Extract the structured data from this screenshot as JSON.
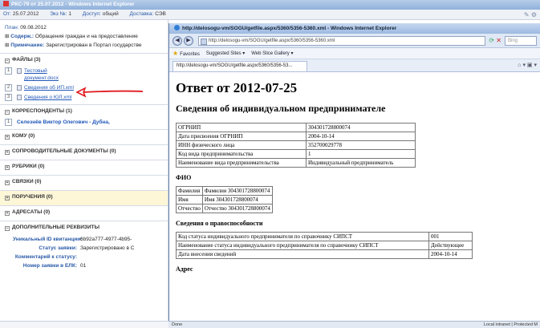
{
  "back_window": {
    "title": "РКС-79 от 25.07.2012 - Windows Internet Explorer",
    "meta": {
      "from_label": "От:",
      "from_value": "25.07.2012",
      "copy_label": "Экз №:",
      "copy_value": "1",
      "access_label": "Доступ:",
      "access_value": "общий",
      "delivery_label": "Доставка:",
      "delivery_value": "СЭВ"
    },
    "plan_label": "План:",
    "plan_value": "09.08.2012",
    "content_label": "Содерж.:",
    "content_value": "Обращения граждан и на предоставление",
    "note_label": "Примечание:",
    "note_value": "Зарегистрирован в Портал государстве",
    "files": {
      "header": "ФАЙЛЫ (3)",
      "items": [
        {
          "num": "1",
          "name": "Тестовый документ.docx"
        },
        {
          "num": "2",
          "name": "Сведения об ИП.xml"
        },
        {
          "num": "3",
          "name": "Сведения о ЮЛ.xml"
        }
      ]
    },
    "correspondents": {
      "header": "КОРРЕСПОНДЕНТЫ (1)",
      "items": [
        {
          "num": "1",
          "name": "Селезнёв Виктор Олегович - Дубна,"
        }
      ]
    },
    "sections": [
      {
        "header": "КОМУ (0)"
      },
      {
        "header": "СОПРОВОДИТЕЛЬНЫЕ ДОКУМЕНТЫ (0)"
      },
      {
        "header": "РУБРИКИ (0)"
      },
      {
        "header": "СВЯЗКИ (0)"
      },
      {
        "header": "ПОРУЧЕНИЯ (0)"
      },
      {
        "header": "АДРЕСАТЫ (0)"
      }
    ],
    "extra": {
      "header": "ДОПОЛНИТЕЛЬНЫЕ РЕКВИЗИТЫ",
      "rows": [
        {
          "k": "Уникальный ID квитанции:",
          "v": "6b92a777-4977-4b95-"
        },
        {
          "k": "Статус заявки:",
          "v": "Зарегистрировано в С"
        },
        {
          "k": "Комментарий к статусу:",
          "v": ""
        },
        {
          "k": "Номер заявки в ЕЛК:",
          "v": "01"
        }
      ]
    }
  },
  "popup": {
    "title": "http://delosogu-vm/SOGU/getfile.aspx/5360/5356-5360.xml - Windows Internet Explorer",
    "address": "http://delosogu-vm/SOGU/getfile.aspx/5360/5356-5360.xml",
    "search_placeholder": "Bing",
    "favorites": "Favorites",
    "suggested": "Suggested Sites ▾",
    "gallery": "Web Slice Gallery ▾",
    "tab_label": "http://delosogu-vm/SOGU/getfile.aspx/5360/5356-53...",
    "status_left": "Done",
    "status_right": "Local intranet | Protected M",
    "doc": {
      "title": "Ответ от 2012-07-25",
      "subtitle": "Сведения об индивидуальном предпринимателе",
      "main_table": [
        [
          "ОГРНИП",
          "304301728800074"
        ],
        [
          "Дата присвоения ОГРНИП",
          "2004-10-14"
        ],
        [
          "ИНН физического лица",
          "352700029778"
        ],
        [
          "Код вида предпринимательства",
          "1"
        ],
        [
          "Наименование вида предпринимательства",
          "Индивидуальный предприниматель"
        ]
      ],
      "fio_heading": "ФИО",
      "fio_table": [
        [
          "Фамилия",
          "Фамилия 304301728800074"
        ],
        [
          "Имя",
          "Имя 304301728800074"
        ],
        [
          "Отчество",
          "Отчество 304301728800074"
        ]
      ],
      "legal_heading": "Сведения о правоспособности",
      "legal_table": [
        [
          "Код статуса индивидуального предпринимателя по справочнику СИПСТ",
          "001"
        ],
        [
          "Наименование статуса индивидуального предпринимателя по справочнику СИПСТ",
          "Действующее"
        ],
        [
          "Дата внесения сведений",
          "2004-10-14"
        ]
      ],
      "address_heading": "Адрес"
    }
  }
}
